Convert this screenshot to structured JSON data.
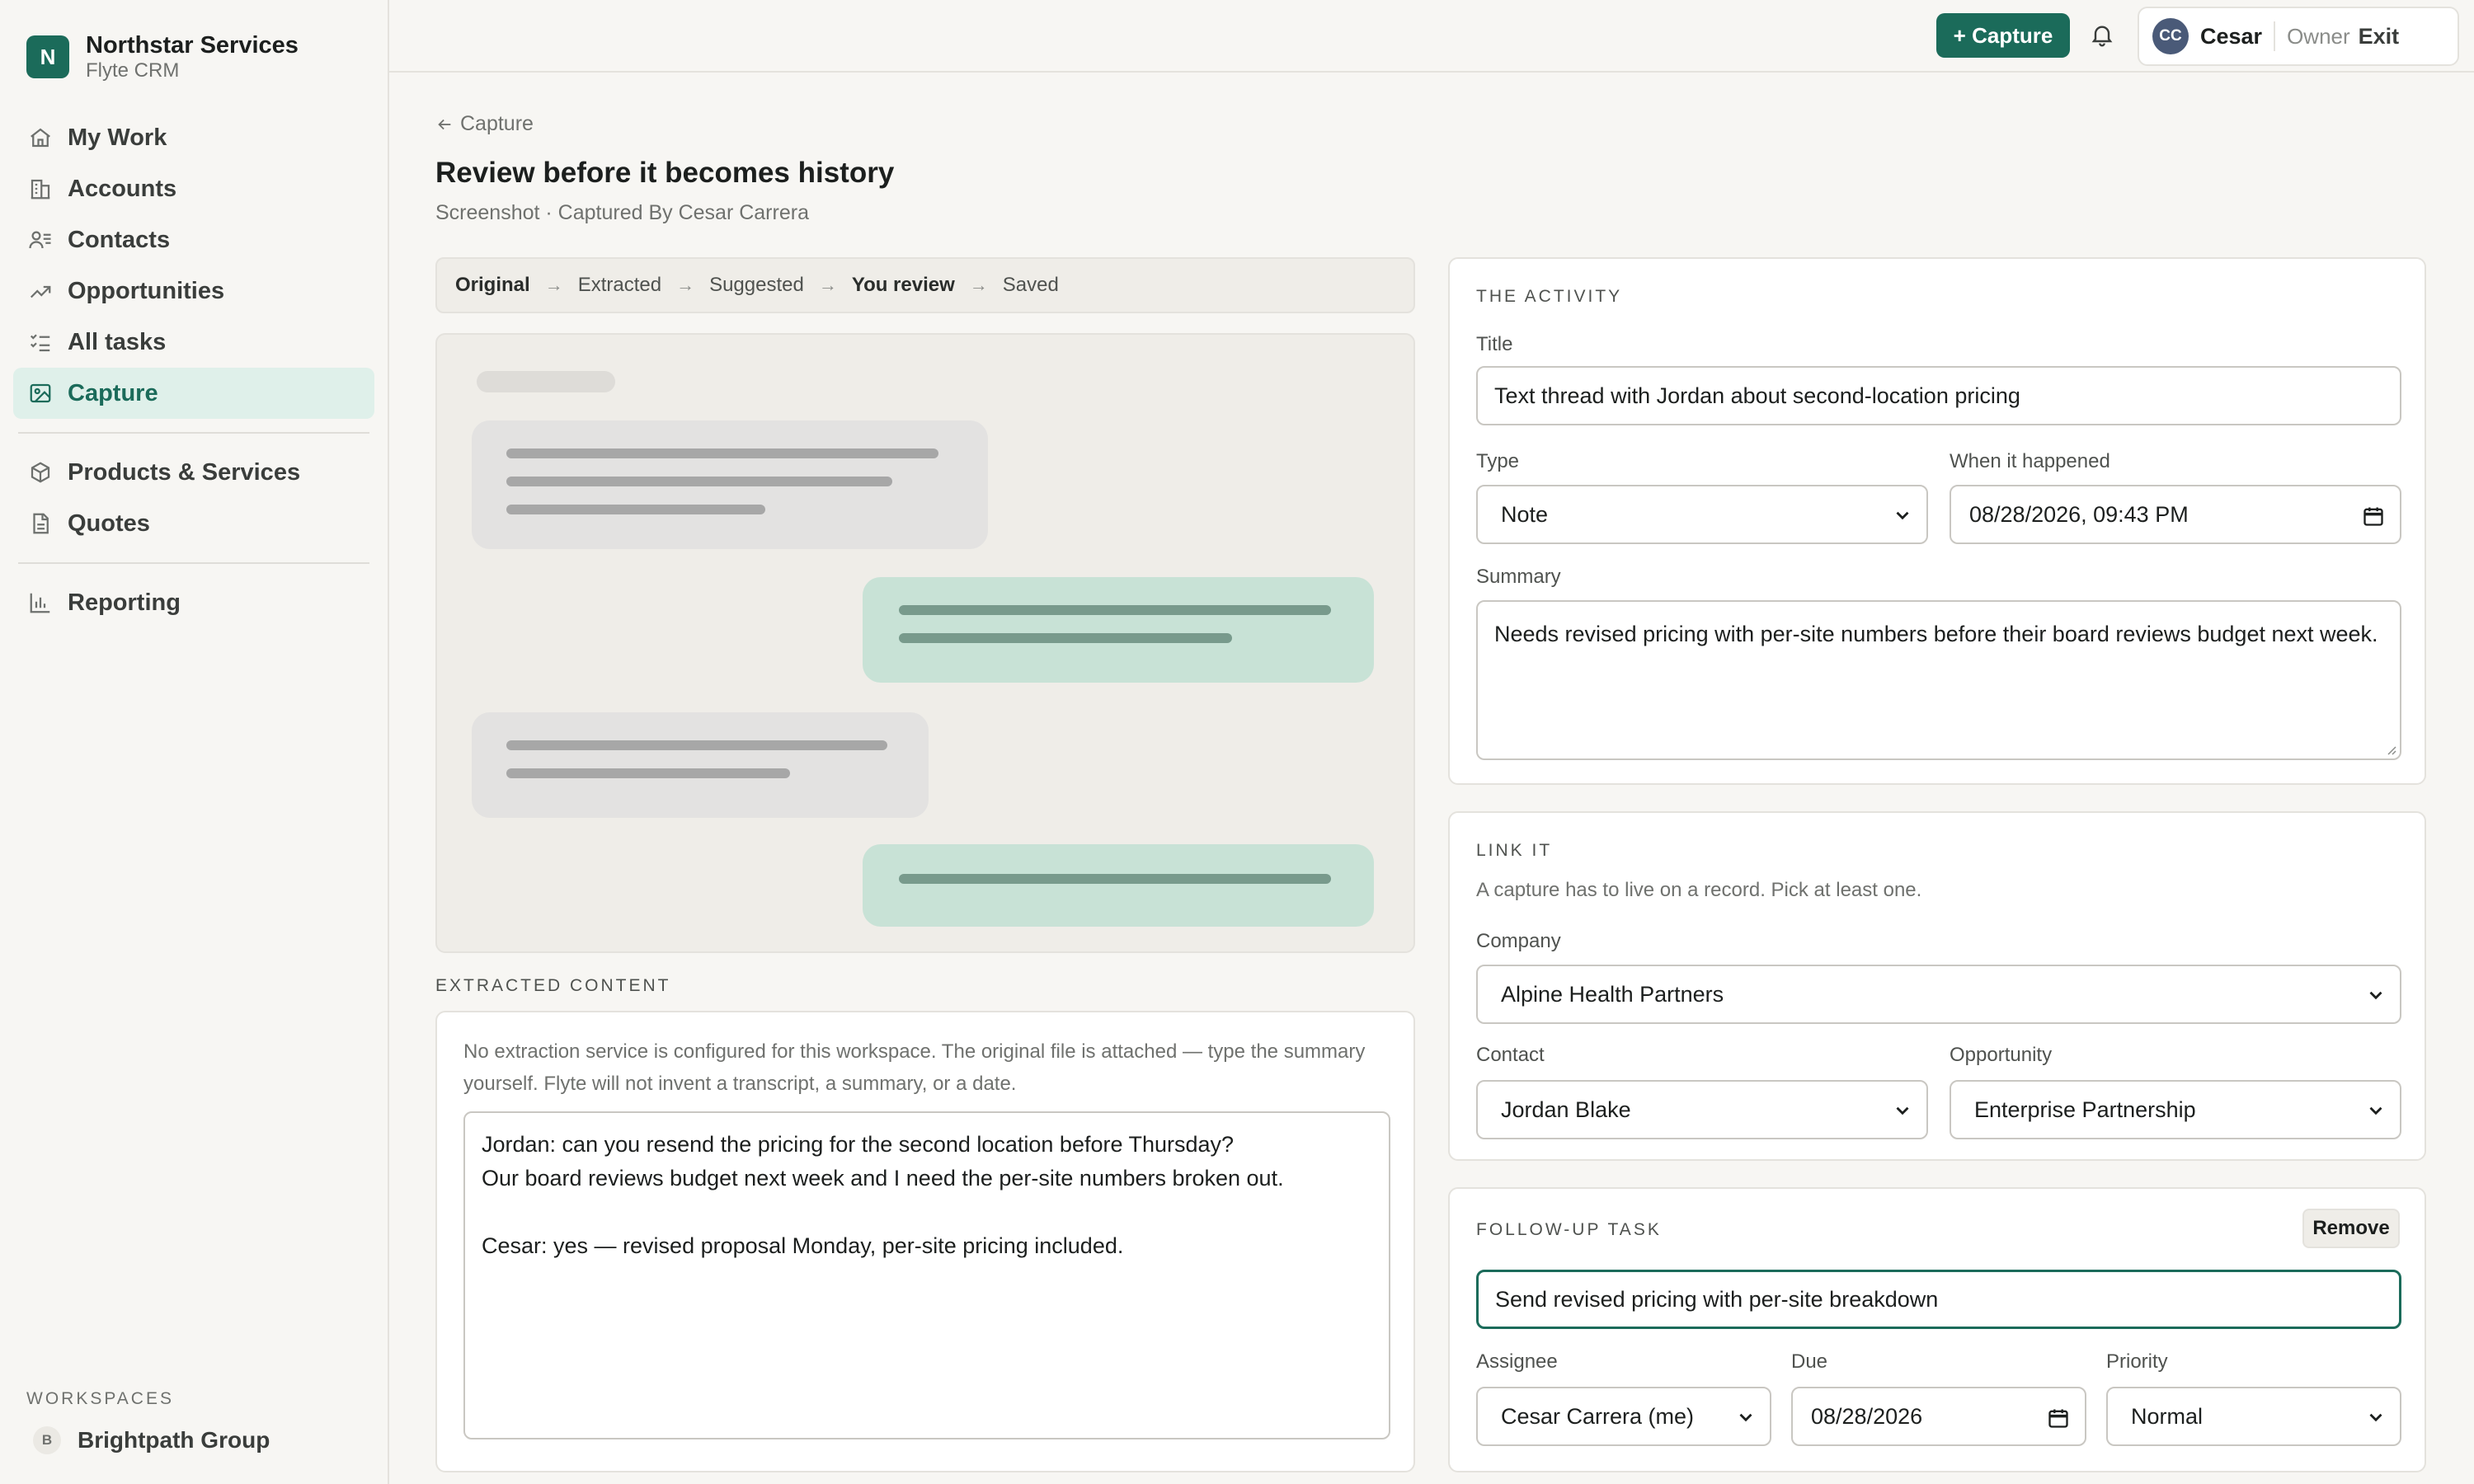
{
  "brand": {
    "initial": "N",
    "name": "Northstar Services",
    "sub": "Flyte CRM"
  },
  "nav": {
    "my_work": "My Work",
    "accounts": "Accounts",
    "contacts": "Contacts",
    "opportunities": "Opportunities",
    "all_tasks": "All tasks",
    "capture": "Capture",
    "products": "Products & Services",
    "quotes": "Quotes",
    "reporting": "Reporting"
  },
  "workspaces": {
    "label": "WORKSPACES",
    "items": [
      {
        "badge": "B",
        "name": "Brightpath Group"
      }
    ]
  },
  "topbar": {
    "capture_label": "+ Capture",
    "user": {
      "initials": "CC",
      "name": "Cesar",
      "role": "Owner",
      "exit": "Exit"
    }
  },
  "page": {
    "back": "Capture",
    "title": "Review before it becomes history",
    "subtitle": "Screenshot · Captured By Cesar Carrera"
  },
  "pipeline": [
    "Original",
    "Extracted",
    "Suggested",
    "You review",
    "Saved"
  ],
  "extracted": {
    "label": "EXTRACTED CONTENT",
    "note": "No extraction service is configured for this workspace. The original file is attached — type the summary yourself. Flyte will not invent a transcript, a summary, or a date.",
    "text": "Jordan: can you resend the pricing for the second location before Thursday?\nOur board reviews budget next week and I need the per-site numbers broken out.\n\nCesar: yes — revised proposal Monday, per-site pricing included."
  },
  "activity": {
    "label": "THE ACTIVITY",
    "title_label": "Title",
    "title_value": "Text thread with Jordan about second-location pricing",
    "type_label": "Type",
    "type_value": "Note",
    "when_label": "When it happened",
    "when_value": "08/28/2026, 09:43 PM",
    "summary_label": "Summary",
    "summary_value": "Needs revised pricing with per-site numbers before their board reviews budget next week."
  },
  "link": {
    "label": "LINK IT",
    "help": "A capture has to live on a record. Pick at least one.",
    "company_label": "Company",
    "company_value": "Alpine Health Partners",
    "contact_label": "Contact",
    "contact_value": "Jordan Blake",
    "opportunity_label": "Opportunity",
    "opportunity_value": "Enterprise Partnership"
  },
  "followup": {
    "label": "FOLLOW-UP TASK",
    "remove": "Remove",
    "task_value": "Send revised pricing with per-site breakdown",
    "assignee_label": "Assignee",
    "assignee_value": "Cesar Carrera (me)",
    "due_label": "Due",
    "due_value": "08/28/2026",
    "priority_label": "Priority",
    "priority_value": "Normal"
  },
  "colors": {
    "accent": "#1b6b5a",
    "accent_soft": "#dff0ea",
    "bubble_out": "#c8e2d6",
    "bubble_in": "#e3e2e1"
  }
}
